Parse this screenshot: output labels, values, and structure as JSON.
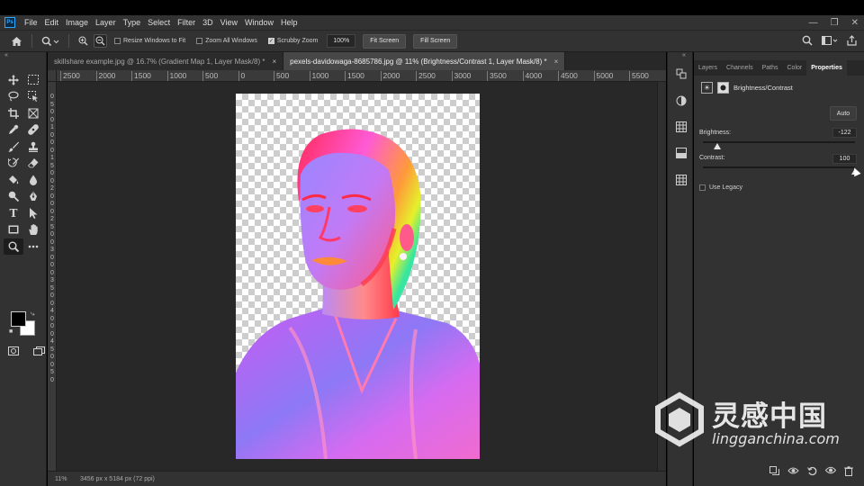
{
  "app": {
    "logo_text": "Ps"
  },
  "menu": [
    "File",
    "Edit",
    "Image",
    "Layer",
    "Type",
    "Select",
    "Filter",
    "3D",
    "View",
    "Window",
    "Help"
  ],
  "window_controls": {
    "minimize": "—",
    "restore": "❐",
    "close": "✕"
  },
  "options_bar": {
    "resize_windows_to_fit": {
      "label": "Resize Windows to Fit",
      "checked": false
    },
    "zoom_all_windows": {
      "label": "Zoom All Windows",
      "checked": false
    },
    "scrubby_zoom": {
      "label": "Scrubby Zoom",
      "checked": true
    },
    "zoom_value": "100%",
    "fit_screen_label": "Fit Screen",
    "fill_screen_label": "Fill Screen"
  },
  "collapse_left": "«",
  "collapse_right": "«",
  "document_tabs": [
    {
      "label": "skillshare example.jpg @ 16.7% (Gradient Map 1, Layer Mask/8) *",
      "close": "×",
      "active": false
    },
    {
      "label": "pexels-davidowaga-8685786.jpg @ 11% (Brightness/Contrast 1, Layer Mask/8) *",
      "close": "×",
      "active": true
    }
  ],
  "ruler": {
    "top_labels": [
      "2500",
      "2000",
      "1500",
      "1000",
      "500",
      "0",
      "500",
      "1000",
      "1500",
      "2000",
      "2500",
      "3000",
      "3500",
      "4000",
      "4500",
      "5000",
      "5500"
    ],
    "left_digits": [
      "0",
      "5",
      "0",
      "0",
      "1",
      "0",
      "0",
      "0",
      "1",
      "5",
      "0",
      "0",
      "2",
      "0",
      "0",
      "0",
      "2",
      "5",
      "0",
      "0",
      "3",
      "0",
      "0",
      "0",
      "3",
      "5",
      "0",
      "0",
      "4",
      "0",
      "0",
      "0",
      "4",
      "5",
      "0",
      "0",
      "5",
      "0"
    ]
  },
  "status": {
    "zoom": "11%",
    "info": "3456 px x 5184 px (72 ppi)"
  },
  "panel_tabs": [
    {
      "label": "Layers",
      "active": false
    },
    {
      "label": "Channels",
      "active": false
    },
    {
      "label": "Paths",
      "active": false
    },
    {
      "label": "Color",
      "active": false
    },
    {
      "label": "Properties",
      "active": true
    }
  ],
  "properties": {
    "adjustment_title": "Brightness/Contrast",
    "auto_label": "Auto",
    "brightness": {
      "label": "Brightness:",
      "value": "-122",
      "range": [
        -150,
        150
      ]
    },
    "contrast": {
      "label": "Contrast:",
      "value": "100",
      "range": [
        -50,
        100
      ]
    },
    "use_legacy": {
      "label": "Use Legacy",
      "checked": false
    }
  },
  "icons": {
    "home": "home-icon",
    "zoom": "zoom-tool-icon",
    "search": "search-icon",
    "workspace": "workspace-icon",
    "share": "share-icon"
  },
  "watermark": {
    "cn": "灵感中国",
    "url": "lingganchina.com"
  }
}
